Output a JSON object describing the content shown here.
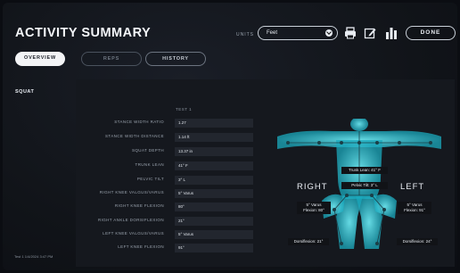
{
  "header": {
    "title": "ACTIVITY SUMMARY",
    "units_label": "UNITS",
    "units_value": "Feet",
    "done_label": "DONE"
  },
  "toolbar_icons": [
    "print-icon",
    "edit-icon",
    "bar-chart-icon"
  ],
  "tabs": [
    {
      "label": "OVERVIEW",
      "active": true
    },
    {
      "label": "REPS",
      "active": false
    },
    {
      "label": "HISTORY",
      "active": false
    }
  ],
  "sidebar": {
    "exercise": "SQUAT",
    "timestamp": "Test 1 1/4/2024 3:47 PM"
  },
  "metrics": {
    "column_header": "TEST 1",
    "rows": [
      {
        "label": "STANCE WIDTH RATIO",
        "value": "1.27"
      },
      {
        "label": "STANCE WIDTH DISTANCE",
        "value": "1.14 ft"
      },
      {
        "label": "SQUAT DEPTH",
        "value": "13.37 in"
      },
      {
        "label": "TRUNK LEAN",
        "value": "41° F"
      },
      {
        "label": "PELVIC TILT",
        "value": "3° L"
      },
      {
        "label": "RIGHT KNEE VALGUS/VARUS",
        "value": "5° Varus"
      },
      {
        "label": "RIGHT KNEE FLEXION",
        "value": "80°"
      },
      {
        "label": "RIGHT ANKLE DORSIFLEXION",
        "value": "21°"
      },
      {
        "label": "LEFT KNEE VALGUS/VARUS",
        "value": "5° Varus"
      },
      {
        "label": "LEFT KNEE FLEXION",
        "value": "91°"
      }
    ]
  },
  "body_view": {
    "right_label": "RIGHT",
    "left_label": "LEFT",
    "trunk_lean": "Trunk Lean: 41° F",
    "pelvic_tilt": "Pelvic Tilt: 3° L",
    "right_knee_varus": "5° Varus",
    "right_knee_flexion": "Flexion: 80°",
    "left_knee_varus": "5° Varus",
    "left_knee_flexion": "Flexion: 91°",
    "right_dorsiflexion": "Dorsiflexion: 21°",
    "left_dorsiflexion": "Dorsiflexion: 24°",
    "accent_color": "#4fe3f0"
  }
}
